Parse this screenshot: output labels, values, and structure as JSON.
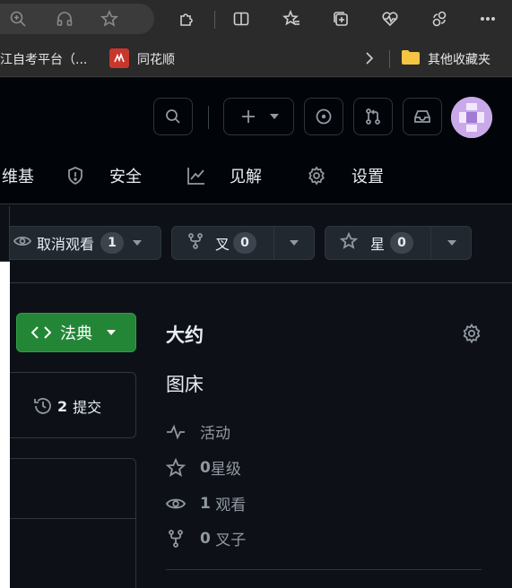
{
  "browser": {
    "toolbar_icons": [
      "zoom-in-icon",
      "read-aloud-icon",
      "favorite-star-icon",
      "extensions-icon",
      "split-screen-icon",
      "favorites-icon",
      "collections-icon",
      "browser-essentials-icon",
      "copilot-icon",
      "more-icon"
    ]
  },
  "favorites_bar": {
    "items": [
      {
        "label": "江自考平台（..."
      },
      {
        "label": "同花顺"
      }
    ],
    "other_favorites": "其他收藏夹"
  },
  "repo_nav": {
    "tabs": [
      {
        "label": "维基"
      },
      {
        "label": "安全"
      },
      {
        "label": "见解"
      },
      {
        "label": "设置"
      }
    ]
  },
  "actions": {
    "watch": {
      "label": "取消观看",
      "count": "1"
    },
    "fork": {
      "label": "叉",
      "count": "0"
    },
    "star": {
      "label": "星",
      "count": "0"
    }
  },
  "code_button": {
    "label": "法典"
  },
  "commits": {
    "count": "2",
    "label": "提交"
  },
  "about": {
    "title": "大约",
    "description": "图床",
    "activity": "活动",
    "stars_count": "0",
    "stars_label": "星级",
    "watchers_count": "1",
    "watchers_label": "观看",
    "forks_count": "0",
    "forks_label": "叉子"
  },
  "colors": {
    "accent_green": "#238636",
    "background": "#0d1117",
    "header_bg": "#010409",
    "muted": "#9198a1"
  }
}
